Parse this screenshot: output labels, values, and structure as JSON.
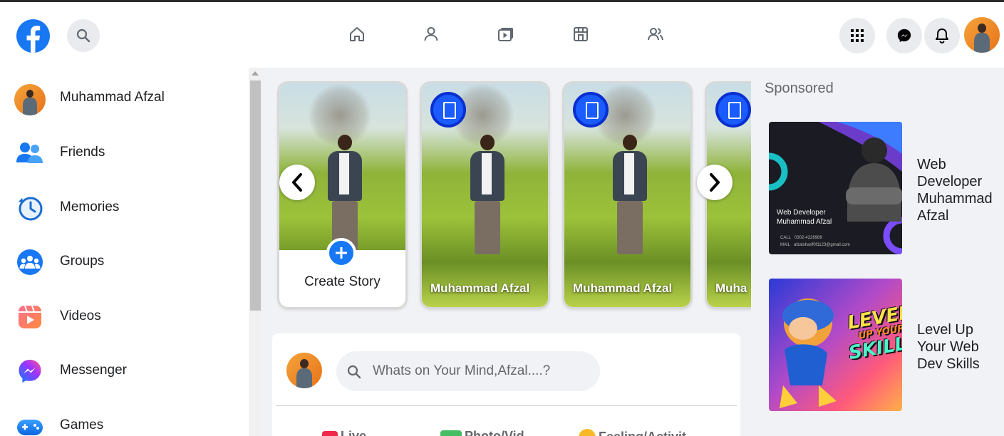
{
  "profile": {
    "name": "Muhammad Afzal"
  },
  "sidebar": {
    "items": [
      {
        "label": "Muhammad Afzal",
        "icon": "profile-avatar"
      },
      {
        "label": "Friends",
        "icon": "friends-icon"
      },
      {
        "label": "Memories",
        "icon": "memories-icon"
      },
      {
        "label": "Groups",
        "icon": "groups-icon"
      },
      {
        "label": "Videos",
        "icon": "videos-icon"
      },
      {
        "label": "Messenger",
        "icon": "messenger-icon"
      },
      {
        "label": "Games",
        "icon": "games-icon"
      }
    ]
  },
  "stories": {
    "create_label": "Create Story",
    "items": [
      {
        "name": "Muhammad Afzal"
      },
      {
        "name": "Muhammad Afzal"
      },
      {
        "name": "Muha"
      }
    ]
  },
  "composer": {
    "placeholder": "Whats on Your Mind,Afzal....?",
    "actions": [
      "Live",
      "Photo/Vid",
      "Feeling/Activit"
    ]
  },
  "sponsored": {
    "title": "Sponsored",
    "ads": [
      {
        "caption": "Web Developer Muhammad Afzal",
        "image_text": {
          "line1": "Web Developer",
          "line2": "Muhammad Afzal",
          "call_label": "CALL",
          "call_value": "0302-4226989",
          "mail_label": "MAIL",
          "mail_value": "afzalsharif0f1123@gmail.com"
        }
      },
      {
        "caption": "Level Up Your Web Dev Skills",
        "image_text": {
          "line1": "LEVEL",
          "line2": "UP YOUR",
          "line3": "SKILLS"
        }
      }
    ]
  },
  "colors": {
    "brand": "#1877f2",
    "background": "#f0f2f5"
  }
}
